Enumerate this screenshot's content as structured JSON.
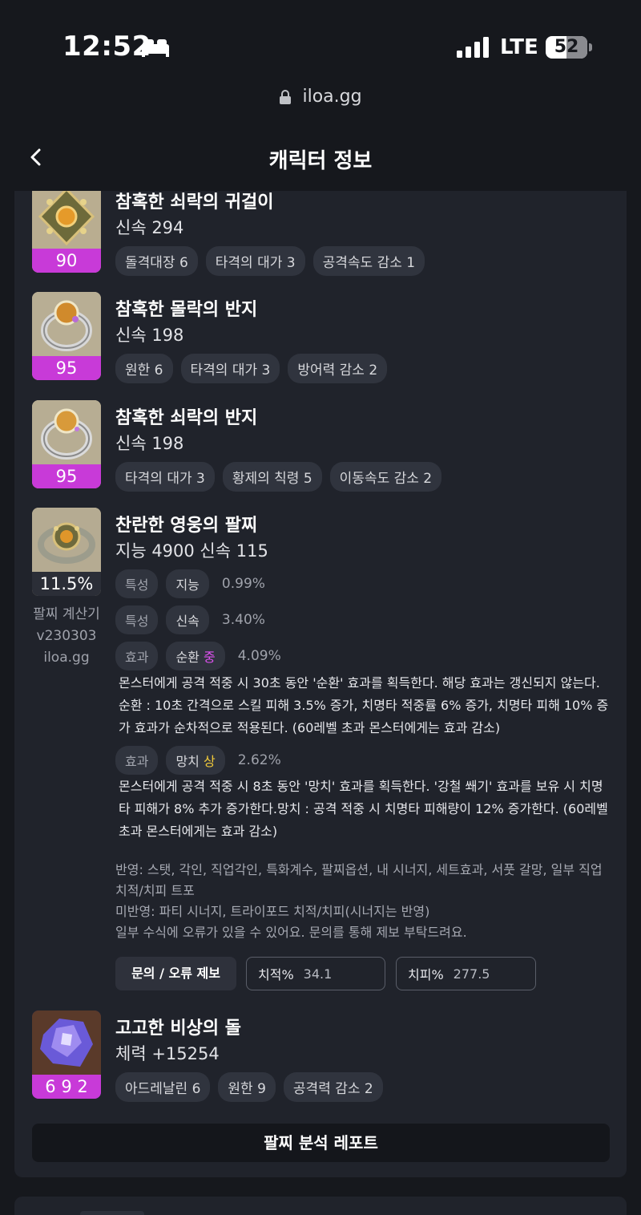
{
  "status_bar": {
    "time": "12:52",
    "network": "LTE",
    "battery": "52",
    "battery_level": 0.52
  },
  "browser": {
    "url": "iloa.gg"
  },
  "nav": {
    "title": "캐릭터 정보"
  },
  "items": [
    {
      "name": "참혹한 쇠락의 귀걸이",
      "stat": "신속 294",
      "level": "90",
      "engravings": [
        "돌격대장 6",
        "타격의 대가 3",
        "공격속도 감소 1"
      ]
    },
    {
      "name": "참혹한 몰락의 반지",
      "stat": "신속 198",
      "level": "95",
      "engravings": [
        "원한 6",
        "타격의 대가 3",
        "방어력 감소 2"
      ]
    },
    {
      "name": "참혹한 쇠락의 반지",
      "stat": "신속 198",
      "level": "95",
      "engravings": [
        "타격의 대가 3",
        "황제의 칙령 5",
        "이동속도 감소 2"
      ]
    }
  ],
  "bracelet": {
    "name": "찬란한 영웅의 팔찌",
    "stat": "지능 4900  신속 115",
    "percent": "11.5%",
    "calc_lines": [
      "팔찌 계산기",
      "v230303",
      "iloa.gg"
    ],
    "options": [
      {
        "type": "특성",
        "name": "지능",
        "grade": "",
        "value": "0.99%"
      },
      {
        "type": "특성",
        "name": "신속",
        "grade": "",
        "value": "3.40%"
      },
      {
        "type": "효과",
        "name": "순환",
        "grade": "중",
        "value": "4.09%",
        "desc": "몬스터에게 공격 적중 시 30초 동안 '순환' 효과를 획득한다. 해당 효과는 갱신되지 않는다. 순환 : 10초 간격으로 스킬 피해 3.5% 증가, 치명타 적중률 6% 증가, 치명타 피해 10% 증가 효과가 순차적으로 적용된다. (60레벨 초과 몬스터에게는 효과 감소)"
      },
      {
        "type": "효과",
        "name": "망치",
        "grade": "상",
        "value": "2.62%",
        "desc": "몬스터에게 공격 적중 시 8초 동안 '망치' 효과를 획득한다. '강철 쐐기' 효과를 보유 시 치명타 피해가 8% 추가 증가한다.망치 : 공격 적중 시 치명타 피해량이 12% 증가한다. (60레벨 초과 몬스터에게는 효과 감소)"
      }
    ],
    "notes": {
      "applied": "반영: 스탯, 각인, 직업각인, 특화계수, 팔찌옵션, 내 시너지, 세트효과, 서풋 갈망, 일부 직업 치적/치피 트포",
      "not_applied": "미반영: 파티 시너지, 트라이포드 치적/치피(시너지는 반영)",
      "disclaimer": "일부 수식에 오류가 있을 수 있어요. 문의를 통해 제보 부탁드려요."
    },
    "inquiry_button": "문의 / 오류 제보",
    "crit_rate_label": "치적%",
    "crit_rate_value": "34.1",
    "crit_dmg_label": "치피%",
    "crit_dmg_value": "277.5"
  },
  "stone": {
    "name": "고고한 비상의 돌",
    "stat": "체력 +15254",
    "level": "6 9 2",
    "engravings": [
      "아드레날린 6",
      "원한 9",
      "공격력 감소 2"
    ]
  },
  "report_button": "팔찌 분석 레포트",
  "colors": {
    "background": "#16181d",
    "card": "#20232b",
    "chip": "#30343e",
    "level_badge": "#c83ad8",
    "grade_mid": "#e052f2",
    "grade_high": "#f0c93a"
  },
  "icons": [
    "bed-icon",
    "signal-icon",
    "battery-icon",
    "lock-icon",
    "back-icon"
  ]
}
